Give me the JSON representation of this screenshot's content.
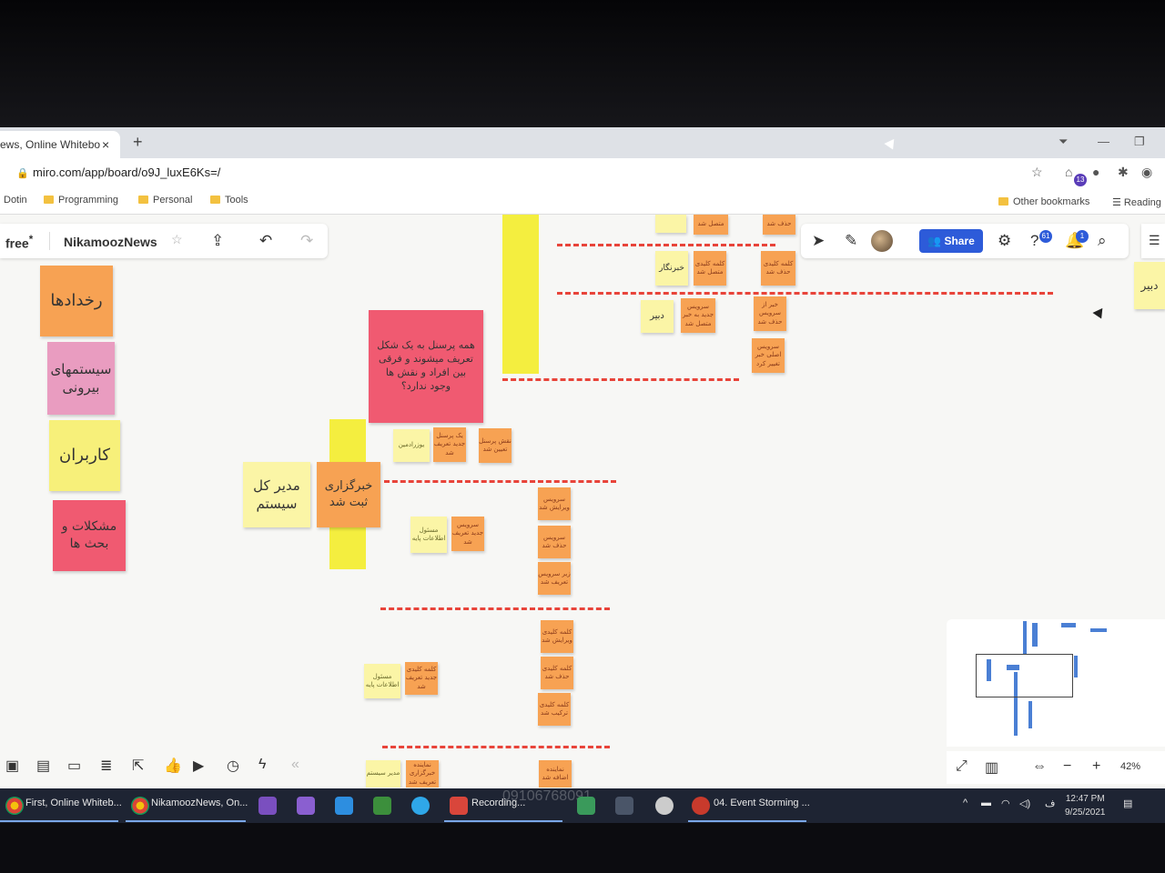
{
  "browser": {
    "tab_title": "ews, Online Whitebo",
    "tab_close": "×",
    "new_tab": "+",
    "url": "miro.com/app/board/o9J_luxE6Ks=/",
    "bookmarks": [
      "Dotin",
      "Programming",
      "Personal",
      "Tools"
    ],
    "other_bookmarks": "Other bookmarks",
    "reading": "Reading",
    "extension_badge": "13"
  },
  "miro": {
    "plan": "free",
    "plan_mark": "*",
    "board_name": "NikamoozNews",
    "share_label": "Share",
    "help_badge": "61",
    "notif_badge": "1",
    "zoom": "42%"
  },
  "stickies": {
    "category_events": "رخدادها",
    "category_external": "سیستمهای بیرونی",
    "category_users": "کاربران",
    "category_problems": "مشکلات و بحث ها",
    "question": "همه پرسنل به یک شکل تعریف میشوند و فرقی بین افراد و نقش ها وجود ندارد؟",
    "admin": "مدیر کل سیستم",
    "agency_registered": "خبرگزاری ثبت شد",
    "reporter": "خبرنگار",
    "editor": "دبیر",
    "editor_right": "دبیر",
    "staff_user": "یوزرادمین",
    "staff_defined": "یک پرسنل جدید تعریف شد",
    "role_assigned": "نقش پرسنل تعیین شد",
    "base_info_officer": "مسئول اطلاعات پایه",
    "service_defined": "سرویس جدید تعریف شد",
    "service_edited": "سرویس ویرایش شد",
    "service_deleted": "سرویس حذف شد",
    "sub_service_defined": "زیر سرویس تعریف شد",
    "keyword_edited": "کلمه کلیدی ویرایش شد",
    "keyword_deleted": "کلمه کلیدی حذف شد",
    "keyword_merged": "کلمه کلیدی ترکیب شد",
    "keyword_defined": "کلمه کلیدی جدید تعریف شد",
    "base_info_officer_2": "مسئول اطلاعات پایه",
    "top_connected": "متصل شد",
    "top_deleted": "حذف شد",
    "keyword_connected": "کلمه کلیدی متصل شد",
    "keyword_removed": "کلمه کلیدی حذف شد",
    "service_to_news": "سرویس جدید به خبر متصل شد",
    "sub_service_news": "خبر از سرویس حذف شد",
    "main_service": "سرویس اصلی خبر تغییر کرد",
    "admin_bottom": "مدیر سیستم",
    "bottom_orange": "نماینده خبرگزاری تعریف شد",
    "bottom_orange_2": "نماینده اضافه شد"
  },
  "taskbar": {
    "tasks": [
      "First, Online Whiteb...",
      "NikamoozNews, On...",
      "Recording...",
      "04. Event Storming ..."
    ],
    "watermark": "09106768091",
    "time": "12:47 PM",
    "date": "9/25/2021",
    "lang": "ف"
  }
}
